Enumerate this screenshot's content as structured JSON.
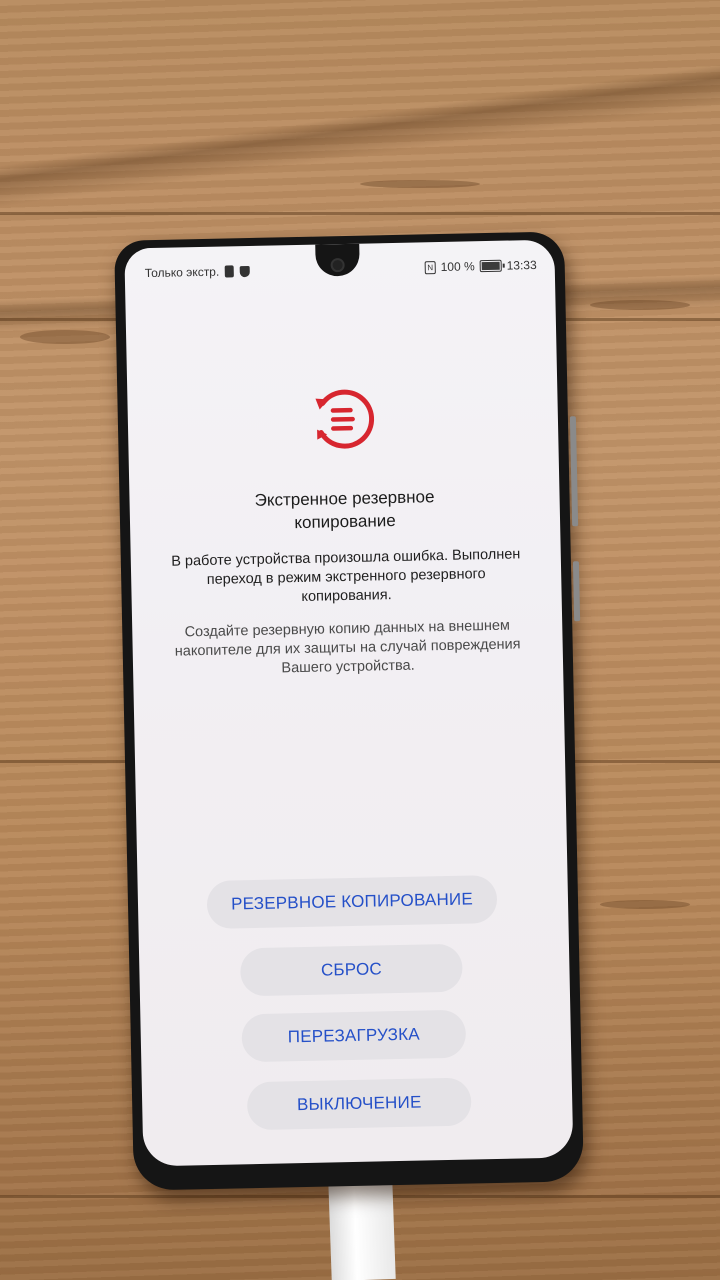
{
  "status_bar": {
    "carrier_text": "Только экстр.",
    "nfc_label": "N",
    "battery_percent": "100 %",
    "time": "13:33"
  },
  "screen": {
    "title": "Экстренное резервное копирование",
    "message": "В работе устройства произошла ошибка. Выполнен переход в режим экстренного резервного копирования.",
    "hint": "Создайте резервную копию данных на внешнем накопителе для их защиты на случай повреждения Вашего устройства.",
    "logo_color": "#d7262f",
    "button_text_color": "#2550c8"
  },
  "buttons": {
    "backup": "РЕЗЕРВНОЕ КОПИРОВАНИЕ",
    "reset": "СБРОС",
    "reboot": "ПЕРЕЗАГРУЗКА",
    "power_off": "ВЫКЛЮЧЕНИЕ"
  }
}
